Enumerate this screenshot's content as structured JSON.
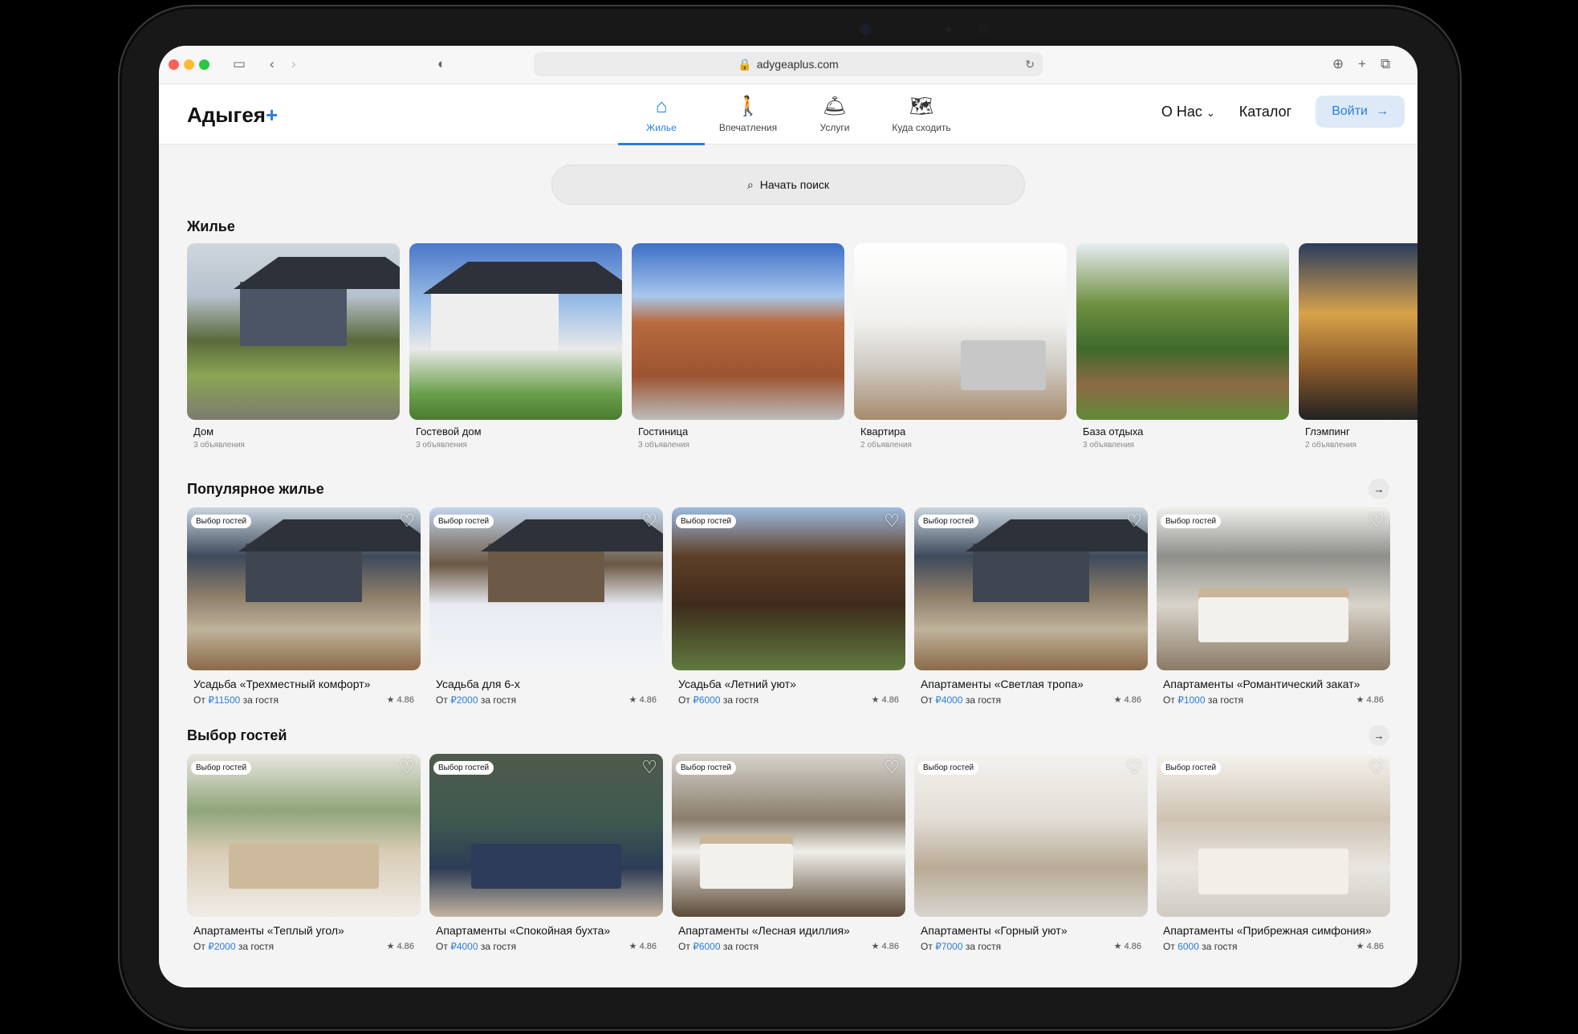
{
  "browser": {
    "url": "adygeaplus.com"
  },
  "header": {
    "logo_text": "Адыгея",
    "logo_plus": "+",
    "tabs": [
      {
        "label": "Жилье",
        "icon": "house-icon",
        "active": true
      },
      {
        "label": "Впечатления",
        "icon": "hiker-icon",
        "active": false
      },
      {
        "label": "Услуги",
        "icon": "service-bell-icon",
        "active": false
      },
      {
        "label": "Куда сходить",
        "icon": "map-pin-icon",
        "active": false
      }
    ],
    "about": "О Нас",
    "catalog": "Каталог",
    "login": "Войти"
  },
  "search": {
    "label": "Начать поиск"
  },
  "housing": {
    "title": "Жилье",
    "categories": [
      {
        "name": "Дом",
        "count": "3 объявления"
      },
      {
        "name": "Гостевой дом",
        "count": "3 объявления"
      },
      {
        "name": "Гостиница",
        "count": "3 объявления"
      },
      {
        "name": "Квартира",
        "count": "2 объявления"
      },
      {
        "name": "База отдыха",
        "count": "3 объявления"
      },
      {
        "name": "Глэмпинг",
        "count": "2 объявления"
      }
    ]
  },
  "popular": {
    "title": "Популярное жилье",
    "items": [
      {
        "badge": "Выбор гостей",
        "name": "Усадьба «Трехместный комфорт»",
        "from": "От",
        "price": "₽11500",
        "per": "за гостя",
        "rating": "★ 4.86"
      },
      {
        "badge": "Выбор гостей",
        "name": "Усадьба для 6-х",
        "from": "От",
        "price": "₽2000",
        "per": "за гостя",
        "rating": "★ 4.86"
      },
      {
        "badge": "Выбор гостей",
        "name": "Усадьба «Летний уют»",
        "from": "От",
        "price": "₽6000",
        "per": "за гостя",
        "rating": "★ 4.86"
      },
      {
        "badge": "Выбор гостей",
        "name": "Апартаменты «Светлая тропа»",
        "from": "От",
        "price": "₽4000",
        "per": "за гостя",
        "rating": "★ 4.86"
      },
      {
        "badge": "Выбор гостей",
        "name": "Апартаменты «Романтический закат»",
        "from": "От",
        "price": "₽1000",
        "per": "за гостя",
        "rating": "★ 4.86"
      }
    ]
  },
  "choice": {
    "title": "Выбор гостей",
    "items": [
      {
        "badge": "Выбор гостей",
        "name": "Апартаменты «Теплый угол»",
        "from": "От",
        "price": "₽2000",
        "per": "за гостя",
        "rating": "★ 4.86"
      },
      {
        "badge": "Выбор гостей",
        "name": "Апартаменты «Спокойная бухта»",
        "from": "От",
        "price": "₽4000",
        "per": "за гостя",
        "rating": "★ 4.86"
      },
      {
        "badge": "Выбор гостей",
        "name": "Апартаменты «Лесная идиллия»",
        "from": "От",
        "price": "₽6000",
        "per": "за гостя",
        "rating": "★ 4.86"
      },
      {
        "badge": "Выбор гостей",
        "name": "Апартаменты «Горный уют»",
        "from": "От",
        "price": "₽7000",
        "per": "за гостя",
        "rating": "★ 4.86"
      },
      {
        "badge": "Выбор гостей",
        "name": "Апартаменты «Прибрежная симфония»",
        "from": "От",
        "price": "6000",
        "per": "за гостя",
        "rating": "★ 4.86"
      }
    ]
  },
  "colors": {
    "accent": "#2a7de1"
  }
}
